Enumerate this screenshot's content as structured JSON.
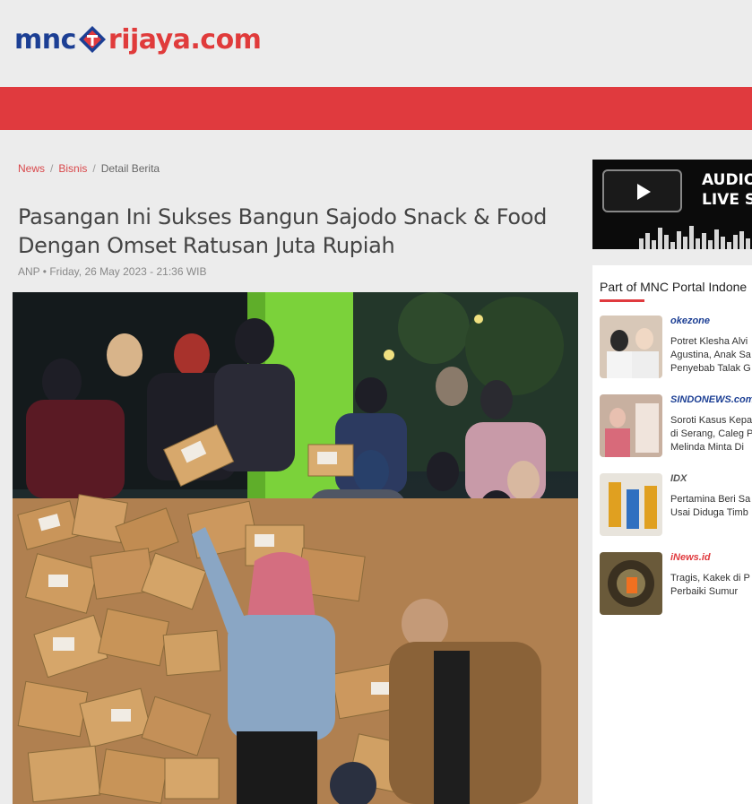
{
  "header": {
    "logo_part1": "mnc",
    "logo_part2": "rijaya.com",
    "accent_color": "#e03a3e",
    "brand_blue": "#1c3f94"
  },
  "breadcrumb": {
    "items": [
      "News",
      "Bisnis",
      "Detail Berita"
    ],
    "separator": "/"
  },
  "article": {
    "title": "Pasangan Ini Sukses Bangun Sajodo Snack & Food Dengan Omset Ratusan Juta Rupiah",
    "meta": "ANP • Friday, 26 May 2023 - 21:36 WIB",
    "image_icon": "group-photo-with-packages"
  },
  "player": {
    "title_line1": "AUDIO",
    "title_line2": "LIVE S",
    "play_icon": "play-icon"
  },
  "portal": {
    "heading": "Part of MNC Portal Indone",
    "items": [
      {
        "source": "okezone",
        "source_color": "#1c3f94",
        "lines": [
          "Potret Klesha Alvi",
          "Agustina, Anak Sa",
          "Penyebab Talak G"
        ]
      },
      {
        "source": "SINDONEWS.com",
        "source_color": "#1c3f94",
        "lines": [
          "Soroti Kasus Kepa",
          "di Serang, Caleg P",
          "Melinda Minta Di"
        ]
      },
      {
        "source": "IDX",
        "source_color": "#555555",
        "lines": [
          "Pertamina Beri Sa",
          "Usai Diduga Timb"
        ]
      },
      {
        "source": "iNews.id",
        "source_color": "#e03a3e",
        "lines": [
          "Tragis, Kakek di P",
          "Perbaiki Sumur"
        ]
      }
    ]
  }
}
